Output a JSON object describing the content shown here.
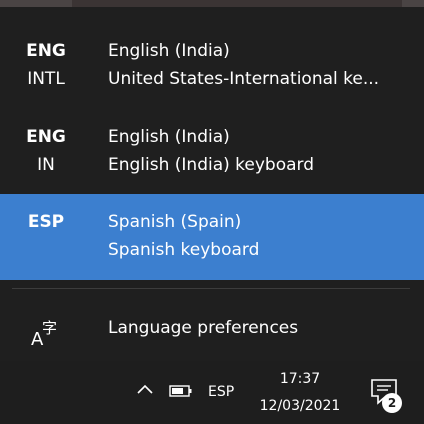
{
  "languages": [
    {
      "code": "ENG",
      "sub_code": "INTL",
      "language": "English (India)",
      "keyboard": "United States-International ke...",
      "selected": false
    },
    {
      "code": "ENG",
      "sub_code": "IN",
      "language": "English (India)",
      "keyboard": "English (India) keyboard",
      "selected": false
    },
    {
      "code": "ESP",
      "sub_code": "",
      "language": "Spanish (Spain)",
      "keyboard": "Spanish keyboard",
      "selected": true
    }
  ],
  "preferences": {
    "label": "Language preferences",
    "icon": "language-preferences-icon"
  },
  "taskbar": {
    "language_indicator": "ESP",
    "time": "17:37",
    "date": "12/03/2021",
    "notification_count": "2",
    "icons": [
      "chevron-up-icon",
      "battery-icon",
      "action-center-icon"
    ]
  },
  "colors": {
    "selected_bg": "#3c7fcf",
    "flyout_bg": "#1f1f1f",
    "taskbar_bg": "#1e1e1e"
  }
}
